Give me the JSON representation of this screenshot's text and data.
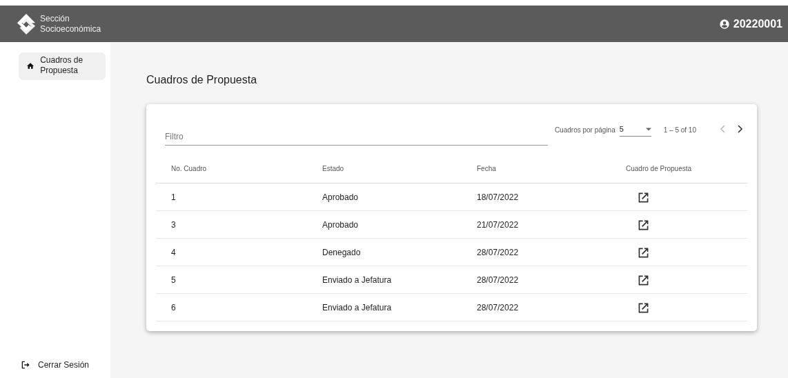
{
  "header": {
    "brand_line_1": "Sección",
    "brand_line_2": "Socioeconómica",
    "user": "20220001"
  },
  "sidebar": {
    "items": [
      {
        "label": "Cuadros de Propuesta",
        "selected": true
      }
    ],
    "logout": "Cerrar Sesión"
  },
  "page_title": "Cuadros de Propuesta",
  "filter": {
    "placeholder": "Filtro"
  },
  "paginator": {
    "label": "Cuadros por página",
    "page_size": "5",
    "range": "1 – 5 of 10",
    "prev_disabled": true,
    "next_disabled": false
  },
  "table": {
    "columns": [
      "No. Cuadro",
      "Estado",
      "Fecha",
      "Cuadro de Propuesta"
    ],
    "rows": [
      {
        "number": "1",
        "status": "Aprobado",
        "date": "18/07/2022"
      },
      {
        "number": "3",
        "status": "Aprobado",
        "date": "21/07/2022"
      },
      {
        "number": "4",
        "status": "Denegado",
        "date": "28/07/2022"
      },
      {
        "number": "5",
        "status": "Enviado a Jefatura",
        "date": "28/07/2022"
      },
      {
        "number": "6",
        "status": "Enviado a Jefatura",
        "date": "28/07/2022"
      }
    ]
  }
}
